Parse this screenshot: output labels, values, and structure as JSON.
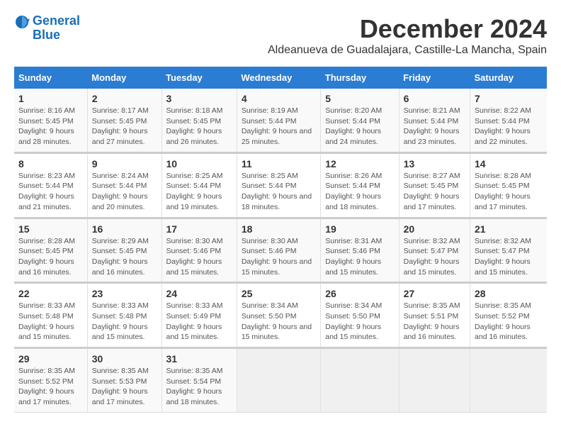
{
  "logo": {
    "line1": "General",
    "line2": "Blue"
  },
  "title": "December 2024",
  "location": "Aldeanueva de Guadalajara, Castille-La Mancha, Spain",
  "days_header": [
    "Sunday",
    "Monday",
    "Tuesday",
    "Wednesday",
    "Thursday",
    "Friday",
    "Saturday"
  ],
  "weeks": [
    [
      {
        "day": "1",
        "sunrise": "8:16 AM",
        "sunset": "5:45 PM",
        "daylight": "9 hours and 28 minutes."
      },
      {
        "day": "2",
        "sunrise": "8:17 AM",
        "sunset": "5:45 PM",
        "daylight": "9 hours and 27 minutes."
      },
      {
        "day": "3",
        "sunrise": "8:18 AM",
        "sunset": "5:45 PM",
        "daylight": "9 hours and 26 minutes."
      },
      {
        "day": "4",
        "sunrise": "8:19 AM",
        "sunset": "5:44 PM",
        "daylight": "9 hours and 25 minutes."
      },
      {
        "day": "5",
        "sunrise": "8:20 AM",
        "sunset": "5:44 PM",
        "daylight": "9 hours and 24 minutes."
      },
      {
        "day": "6",
        "sunrise": "8:21 AM",
        "sunset": "5:44 PM",
        "daylight": "9 hours and 23 minutes."
      },
      {
        "day": "7",
        "sunrise": "8:22 AM",
        "sunset": "5:44 PM",
        "daylight": "9 hours and 22 minutes."
      }
    ],
    [
      {
        "day": "8",
        "sunrise": "8:23 AM",
        "sunset": "5:44 PM",
        "daylight": "9 hours and 21 minutes."
      },
      {
        "day": "9",
        "sunrise": "8:24 AM",
        "sunset": "5:44 PM",
        "daylight": "9 hours and 20 minutes."
      },
      {
        "day": "10",
        "sunrise": "8:25 AM",
        "sunset": "5:44 PM",
        "daylight": "9 hours and 19 minutes."
      },
      {
        "day": "11",
        "sunrise": "8:25 AM",
        "sunset": "5:44 PM",
        "daylight": "9 hours and 18 minutes."
      },
      {
        "day": "12",
        "sunrise": "8:26 AM",
        "sunset": "5:44 PM",
        "daylight": "9 hours and 18 minutes."
      },
      {
        "day": "13",
        "sunrise": "8:27 AM",
        "sunset": "5:45 PM",
        "daylight": "9 hours and 17 minutes."
      },
      {
        "day": "14",
        "sunrise": "8:28 AM",
        "sunset": "5:45 PM",
        "daylight": "9 hours and 17 minutes."
      }
    ],
    [
      {
        "day": "15",
        "sunrise": "8:28 AM",
        "sunset": "5:45 PM",
        "daylight": "9 hours and 16 minutes."
      },
      {
        "day": "16",
        "sunrise": "8:29 AM",
        "sunset": "5:45 PM",
        "daylight": "9 hours and 16 minutes."
      },
      {
        "day": "17",
        "sunrise": "8:30 AM",
        "sunset": "5:46 PM",
        "daylight": "9 hours and 15 minutes."
      },
      {
        "day": "18",
        "sunrise": "8:30 AM",
        "sunset": "5:46 PM",
        "daylight": "9 hours and 15 minutes."
      },
      {
        "day": "19",
        "sunrise": "8:31 AM",
        "sunset": "5:46 PM",
        "daylight": "9 hours and 15 minutes."
      },
      {
        "day": "20",
        "sunrise": "8:32 AM",
        "sunset": "5:47 PM",
        "daylight": "9 hours and 15 minutes."
      },
      {
        "day": "21",
        "sunrise": "8:32 AM",
        "sunset": "5:47 PM",
        "daylight": "9 hours and 15 minutes."
      }
    ],
    [
      {
        "day": "22",
        "sunrise": "8:33 AM",
        "sunset": "5:48 PM",
        "daylight": "9 hours and 15 minutes."
      },
      {
        "day": "23",
        "sunrise": "8:33 AM",
        "sunset": "5:48 PM",
        "daylight": "9 hours and 15 minutes."
      },
      {
        "day": "24",
        "sunrise": "8:33 AM",
        "sunset": "5:49 PM",
        "daylight": "9 hours and 15 minutes."
      },
      {
        "day": "25",
        "sunrise": "8:34 AM",
        "sunset": "5:50 PM",
        "daylight": "9 hours and 15 minutes."
      },
      {
        "day": "26",
        "sunrise": "8:34 AM",
        "sunset": "5:50 PM",
        "daylight": "9 hours and 15 minutes."
      },
      {
        "day": "27",
        "sunrise": "8:35 AM",
        "sunset": "5:51 PM",
        "daylight": "9 hours and 16 minutes."
      },
      {
        "day": "28",
        "sunrise": "8:35 AM",
        "sunset": "5:52 PM",
        "daylight": "9 hours and 16 minutes."
      }
    ],
    [
      {
        "day": "29",
        "sunrise": "8:35 AM",
        "sunset": "5:52 PM",
        "daylight": "9 hours and 17 minutes."
      },
      {
        "day": "30",
        "sunrise": "8:35 AM",
        "sunset": "5:53 PM",
        "daylight": "9 hours and 17 minutes."
      },
      {
        "day": "31",
        "sunrise": "8:35 AM",
        "sunset": "5:54 PM",
        "daylight": "9 hours and 18 minutes."
      },
      null,
      null,
      null,
      null
    ]
  ]
}
